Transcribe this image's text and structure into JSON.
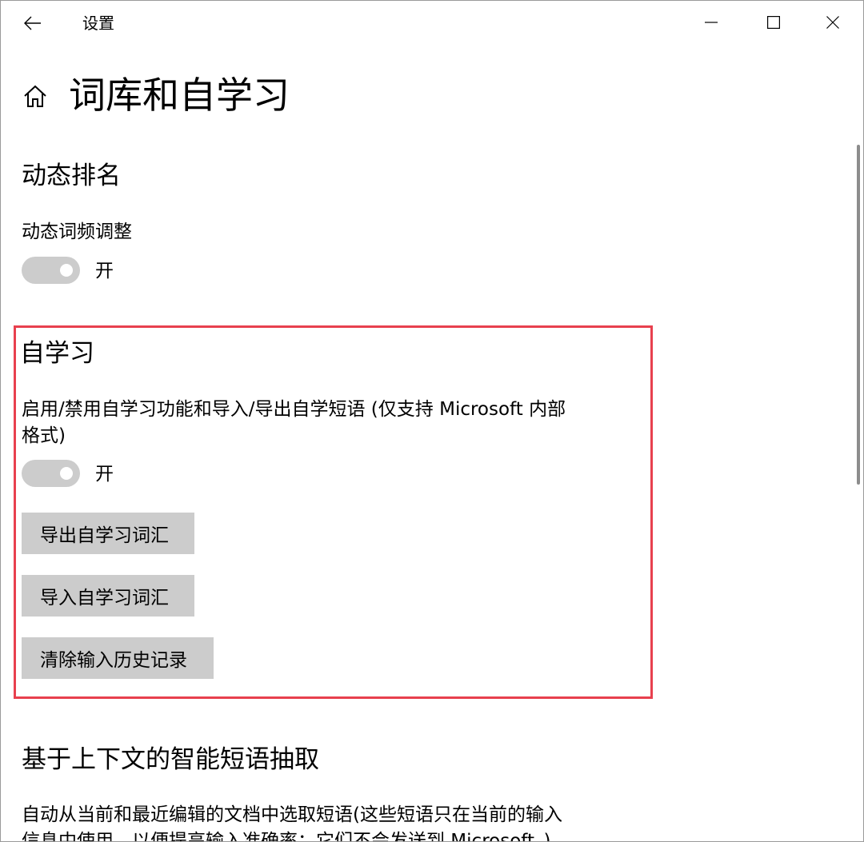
{
  "titlebar": {
    "app_title": "设置",
    "back_icon": "arrow-left-icon",
    "minimize_icon": "minimize-icon",
    "maximize_icon": "maximize-icon",
    "close_icon": "close-icon"
  },
  "page": {
    "home_icon": "home-icon",
    "title": "词库和自学习"
  },
  "dynamic_ranking": {
    "heading": "动态排名",
    "setting_label": "动态词频调整",
    "toggle_state": "开",
    "toggle_on": true
  },
  "self_learning": {
    "heading": "自学习",
    "setting_label_line1": "启用/禁用自学习功能和导入/导出自学短语 (仅支持 Microsoft 内部",
    "setting_label_line2": "格式)",
    "toggle_state": "开",
    "toggle_on": true,
    "export_button": "导出自学习词汇",
    "import_button": "导入自学习词汇",
    "clear_history_button": "清除输入历史记录",
    "highlight_color": "#e8404e"
  },
  "context_phrases": {
    "heading": "基于上下文的智能短语抽取",
    "description_line1": "自动从当前和最近编辑的文档中选取短语(这些短语只在当前的输入",
    "description_line2": "信息中使用，以便提高输入准确率；它们不会发送到 Microsoft。)"
  },
  "colors": {
    "toggle_off_track": "#cccccc",
    "button_bg": "#cccccc",
    "scrollbar": "#8c8c8c"
  }
}
